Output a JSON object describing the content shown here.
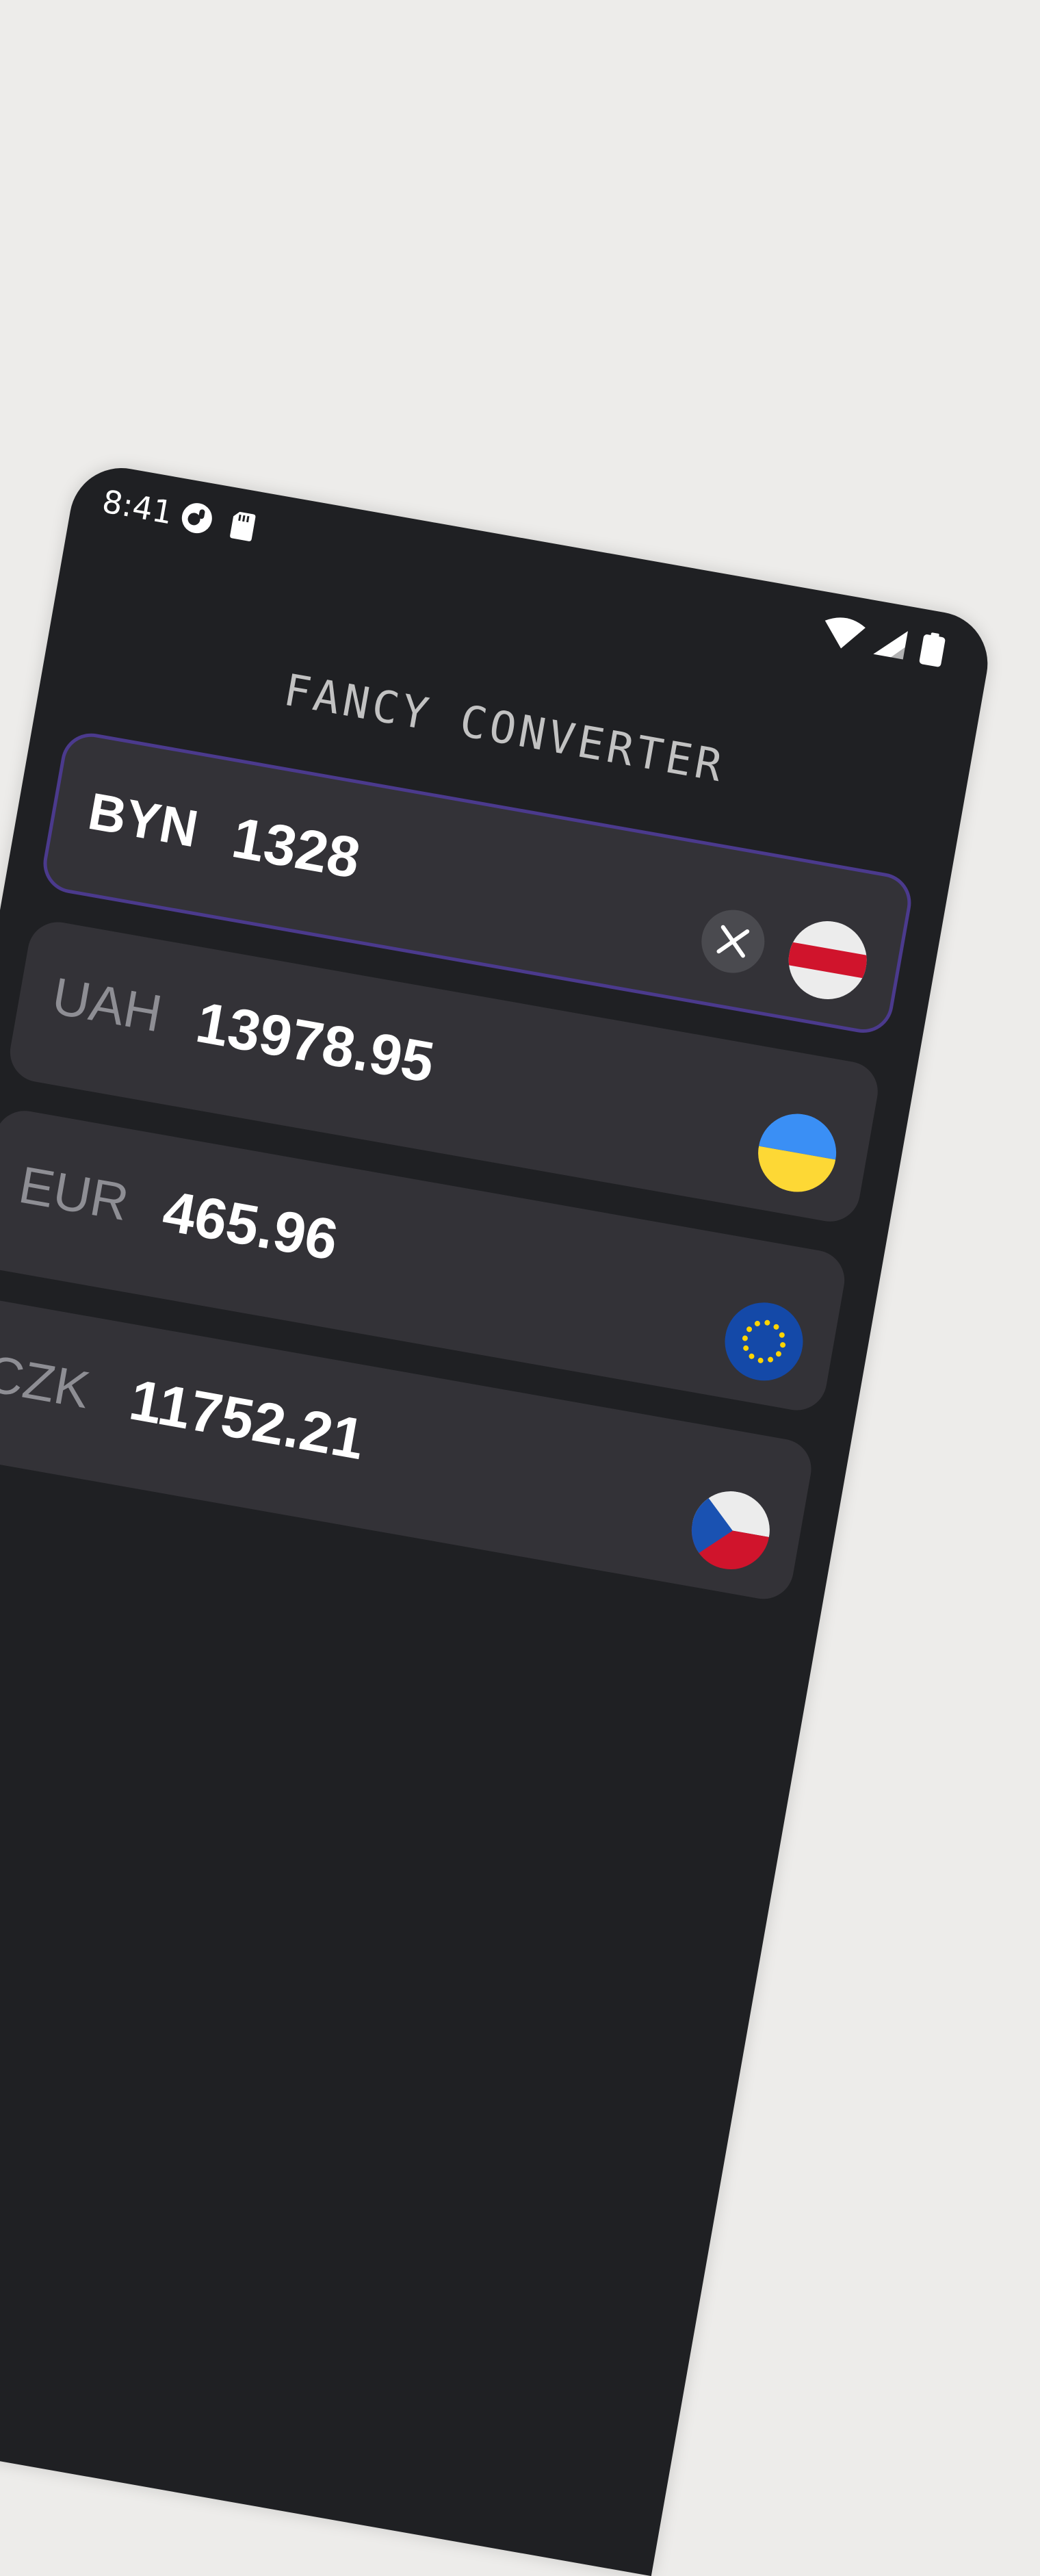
{
  "status_bar": {
    "time": "8:41"
  },
  "app": {
    "title": "FANCY CONVERTER"
  },
  "currencies": [
    {
      "code": "BYN",
      "value": "1328",
      "active": true,
      "flag": "belarus-flag-icon"
    },
    {
      "code": "UAH",
      "value": "13978.95",
      "active": false,
      "flag": "ukraine-flag-icon"
    },
    {
      "code": "EUR",
      "value": "465.96",
      "active": false,
      "flag": "eu-flag-icon"
    },
    {
      "code": "CZK",
      "value": "11752.21",
      "active": false,
      "flag": "czech-flag-icon"
    }
  ],
  "colors": {
    "background": "#edecea",
    "screen": "#1f2023",
    "card": "#333237",
    "active_border": "#4b3a8d"
  },
  "icons": {
    "clear": "close-icon",
    "wifi": "wifi-icon",
    "signal": "signal-icon",
    "battery": "battery-icon",
    "notification_app": "app-notification-icon",
    "sd_card": "sd-card-icon"
  }
}
